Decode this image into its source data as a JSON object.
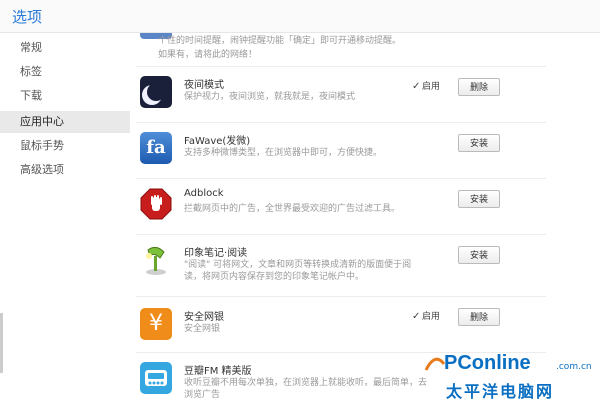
{
  "window": {
    "title": "选项"
  },
  "sidebar": {
    "items": [
      {
        "label": "常规"
      },
      {
        "label": "标签"
      },
      {
        "label": "下载"
      },
      {
        "label": "应用中心",
        "active": true
      },
      {
        "label": "鼠标手势"
      },
      {
        "label": "高级选项"
      }
    ]
  },
  "top_partial": {
    "line1": "个性的时间提醒，闹钟提醒功能「确定」即可开通移动提醒。",
    "line2": "如果有，请将此的网络！"
  },
  "extensions": [
    {
      "name": "夜间模式",
      "desc": "保护视力，夜间浏览，就我就是，夜间模式",
      "icon": "moon-icon",
      "enabled_label": "启用",
      "enabled": true,
      "action_label": "删除"
    },
    {
      "name": "FaWave(发微)",
      "desc": "支持多种微博类型，在浏览器中即可，方便快捷。",
      "icon": "fa-icon",
      "action_label": "安装"
    },
    {
      "name": "Adblock",
      "desc": "拦截网页中的广告，全世界最受欢迎的广告过滤工具。",
      "icon": "stop-hand-icon",
      "action_label": "安装"
    },
    {
      "name": "印象笔记·阅读",
      "desc": "\"阅读\" 可将网文，文章和网页等转换成清新的版面便于阅读，将网页内容保存到您的印象笔记帐户中。",
      "icon": "evernote-reader-icon",
      "action_label": "安装"
    },
    {
      "name": "安全网银",
      "desc": "安全网银",
      "icon": "yen-icon",
      "enabled_label": "启用",
      "enabled": true,
      "action_label": "删除"
    },
    {
      "name": "豆瓣FM 精美版",
      "desc": "收听豆瓣不用每次单独，在浏览器上就能收听，最后简单，去浏览广告",
      "icon": "radio-icon"
    }
  ],
  "watermark": {
    "brand": "PConline",
    "domain": ".com.cn",
    "chinese": "太平洋电脑网"
  }
}
